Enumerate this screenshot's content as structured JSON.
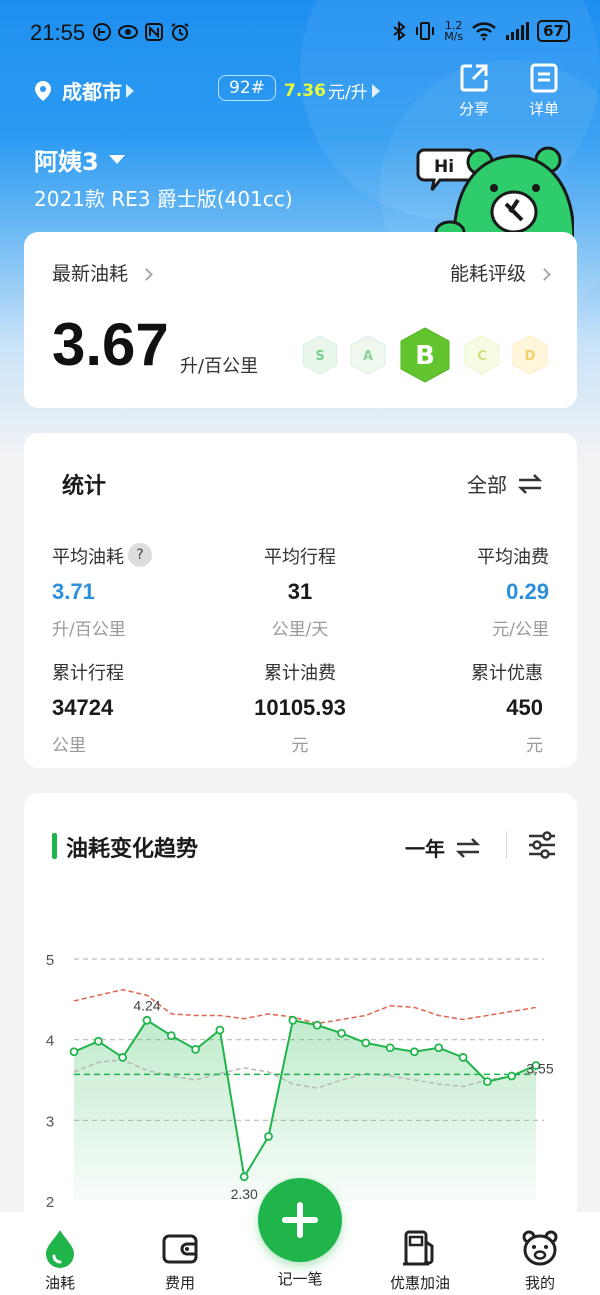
{
  "status": {
    "time": "21:55",
    "net_speed_top": "1.2",
    "net_speed_unit": "M/s",
    "battery": "67"
  },
  "header": {
    "city": "成都市",
    "fuel_grade": "92#",
    "fuel_price_value": "7.36",
    "fuel_price_unit": "元/升",
    "share_label": "分享",
    "detail_label": "详单",
    "car_name": "阿姨3",
    "car_model": "2021款 RE3 爵士版(401cc)",
    "mascot_text": "Hi"
  },
  "consumption": {
    "title": "最新油耗",
    "rating_label": "能耗评级",
    "value": "3.67",
    "unit": "升/百公里",
    "grades": [
      "S",
      "A",
      "B",
      "C",
      "D"
    ],
    "selected_grade": "B"
  },
  "stats": {
    "title": "统计",
    "filter": "全部",
    "help": "?",
    "items": [
      {
        "label": "平均油耗",
        "value": "3.71",
        "unit": "升/百公里"
      },
      {
        "label": "平均行程",
        "value": "31",
        "unit": "公里/天"
      },
      {
        "label": "平均油费",
        "value": "0.29",
        "unit": "元/公里"
      },
      {
        "label": "累计行程",
        "value": "34724",
        "unit": "公里"
      },
      {
        "label": "累计油费",
        "value": "10105.93",
        "unit": "元"
      },
      {
        "label": "累计优惠",
        "value": "450",
        "unit": "元"
      }
    ]
  },
  "trend": {
    "title": "油耗变化趋势",
    "range": "一年"
  },
  "chart_data": {
    "type": "line",
    "ylim": [
      2,
      5
    ],
    "yticks": [
      "5",
      "4",
      "3",
      "2"
    ],
    "annotations": [
      "4.24",
      "2.30",
      "3.55"
    ],
    "series": [
      {
        "values": [
          3.85,
          3.98,
          3.78,
          4.24,
          4.05,
          3.88,
          4.12,
          2.3,
          2.8,
          4.24,
          4.18,
          4.08,
          3.96,
          3.9,
          3.85,
          3.9,
          3.78,
          3.48,
          3.55,
          3.68
        ]
      },
      {
        "values": [
          4.48,
          4.55,
          4.62,
          4.55,
          4.32,
          4.3,
          4.3,
          4.26,
          4.32,
          4.28,
          4.2,
          4.25,
          4.3,
          4.42,
          4.4,
          4.3,
          4.25,
          4.3,
          4.35,
          4.4
        ]
      },
      {
        "values": [
          3.6,
          3.72,
          3.75,
          3.62,
          3.55,
          3.5,
          3.58,
          3.65,
          3.6,
          3.45,
          3.4,
          3.5,
          3.58,
          3.55,
          3.5,
          3.45,
          3.42,
          3.5,
          3.55,
          3.6
        ]
      },
      {
        "values": [
          3.57,
          3.57,
          3.57,
          3.57,
          3.57,
          3.57,
          3.57,
          3.57,
          3.57,
          3.57,
          3.57,
          3.57,
          3.57,
          3.57,
          3.57,
          3.57,
          3.57,
          3.57,
          3.57,
          3.57
        ]
      }
    ],
    "colors": [
      "#1fb54a",
      "#e0654f",
      "#b8b8b8",
      "#1fb54a"
    ]
  },
  "tabs": {
    "fuel": "油耗",
    "cost": "费用",
    "record": "记一笔",
    "deals": "优惠加油",
    "mine": "我的"
  },
  "colors": {
    "accent_green": "#1fb54a",
    "header_blue": "#1e8ff0",
    "value_blue": "#2b8fdc"
  }
}
